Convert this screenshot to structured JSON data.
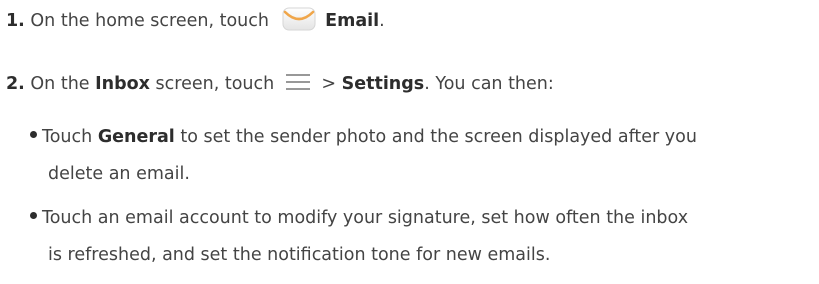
{
  "steps": [
    {
      "num": "1.",
      "text_before": "On the home screen, touch",
      "icon": "email-envelope-icon",
      "bold": "Email",
      "text_after": "."
    },
    {
      "num": "2.",
      "text_a": "On the",
      "bold_a": "Inbox",
      "text_b": "screen, touch",
      "icon": "menu-lines-icon",
      "gt": ">",
      "bold_b": "Settings",
      "text_c": ". You can then:"
    }
  ],
  "bullets": [
    {
      "pre": "Touch",
      "bold": "General",
      "line1_rest": "to set the sender photo and the screen displayed after you",
      "line2": "delete an email."
    },
    {
      "line1": "Touch an email account to modify your signature, set how often the inbox",
      "line2": "is refreshed, and set the notification tone for new emails."
    }
  ],
  "colors": {
    "text": "#444444",
    "bold": "#2d2d2d",
    "icon_orange": "#f0a64a",
    "icon_envelope": "#f2f2f2"
  }
}
